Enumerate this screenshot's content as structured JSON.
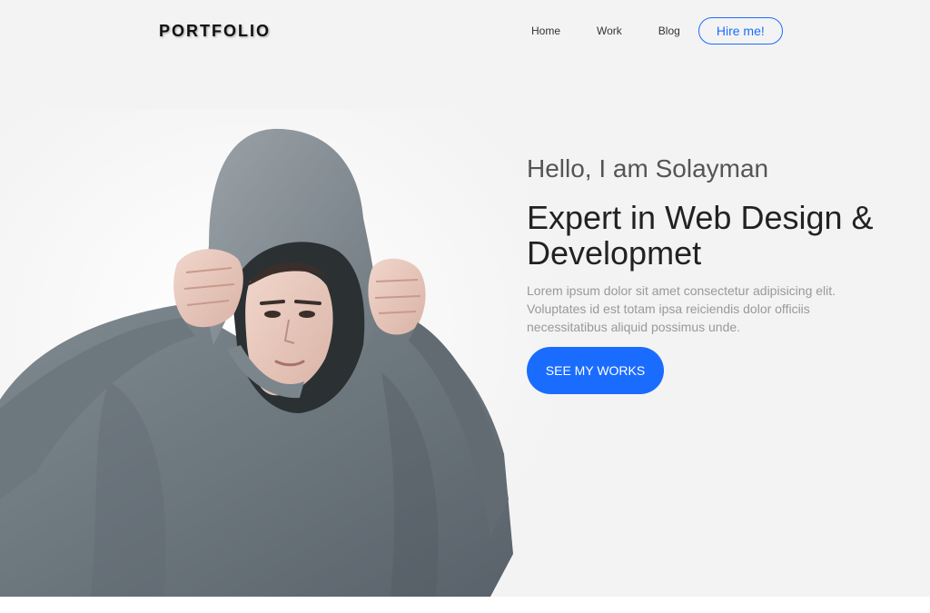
{
  "brand": {
    "logo": "PORTFOLIO"
  },
  "nav": {
    "items": [
      {
        "label": "Home"
      },
      {
        "label": "Work"
      },
      {
        "label": "Blog"
      }
    ],
    "cta_label": "Hire me!"
  },
  "hero": {
    "greeting": "Hello, I am Solayman",
    "headline": "Expert in Web Design & Developmet",
    "description": "Lorem ipsum dolor sit amet consectetur adipisicing elit. Voluptates id est totam ipsa reiciendis dolor officiis necessitatibus aliquid possimus unde.",
    "button_label": "SEE MY WORKS",
    "image": "man-in-grey-hoodie-photo"
  },
  "colors": {
    "accent": "#1a6cff",
    "background": "#f4f3f3",
    "text_dark": "#222222",
    "text_muted": "#999999"
  }
}
